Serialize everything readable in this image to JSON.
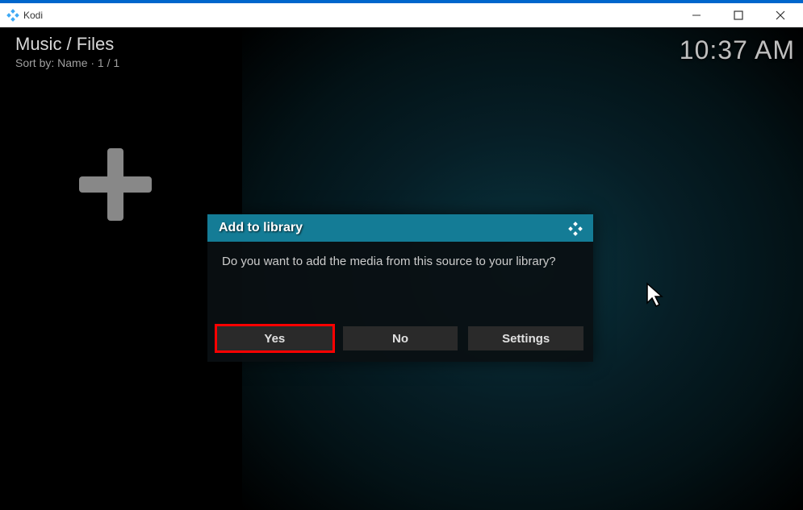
{
  "window": {
    "title": "Kodi"
  },
  "header": {
    "breadcrumb": "Music / Files",
    "sortline": "Sort by: Name  · 1 / 1",
    "clock": "10:37 AM"
  },
  "dialog": {
    "title": "Add to library",
    "message": "Do you want to add the media from this source to your library?",
    "buttons": {
      "yes": "Yes",
      "no": "No",
      "settings": "Settings"
    }
  }
}
